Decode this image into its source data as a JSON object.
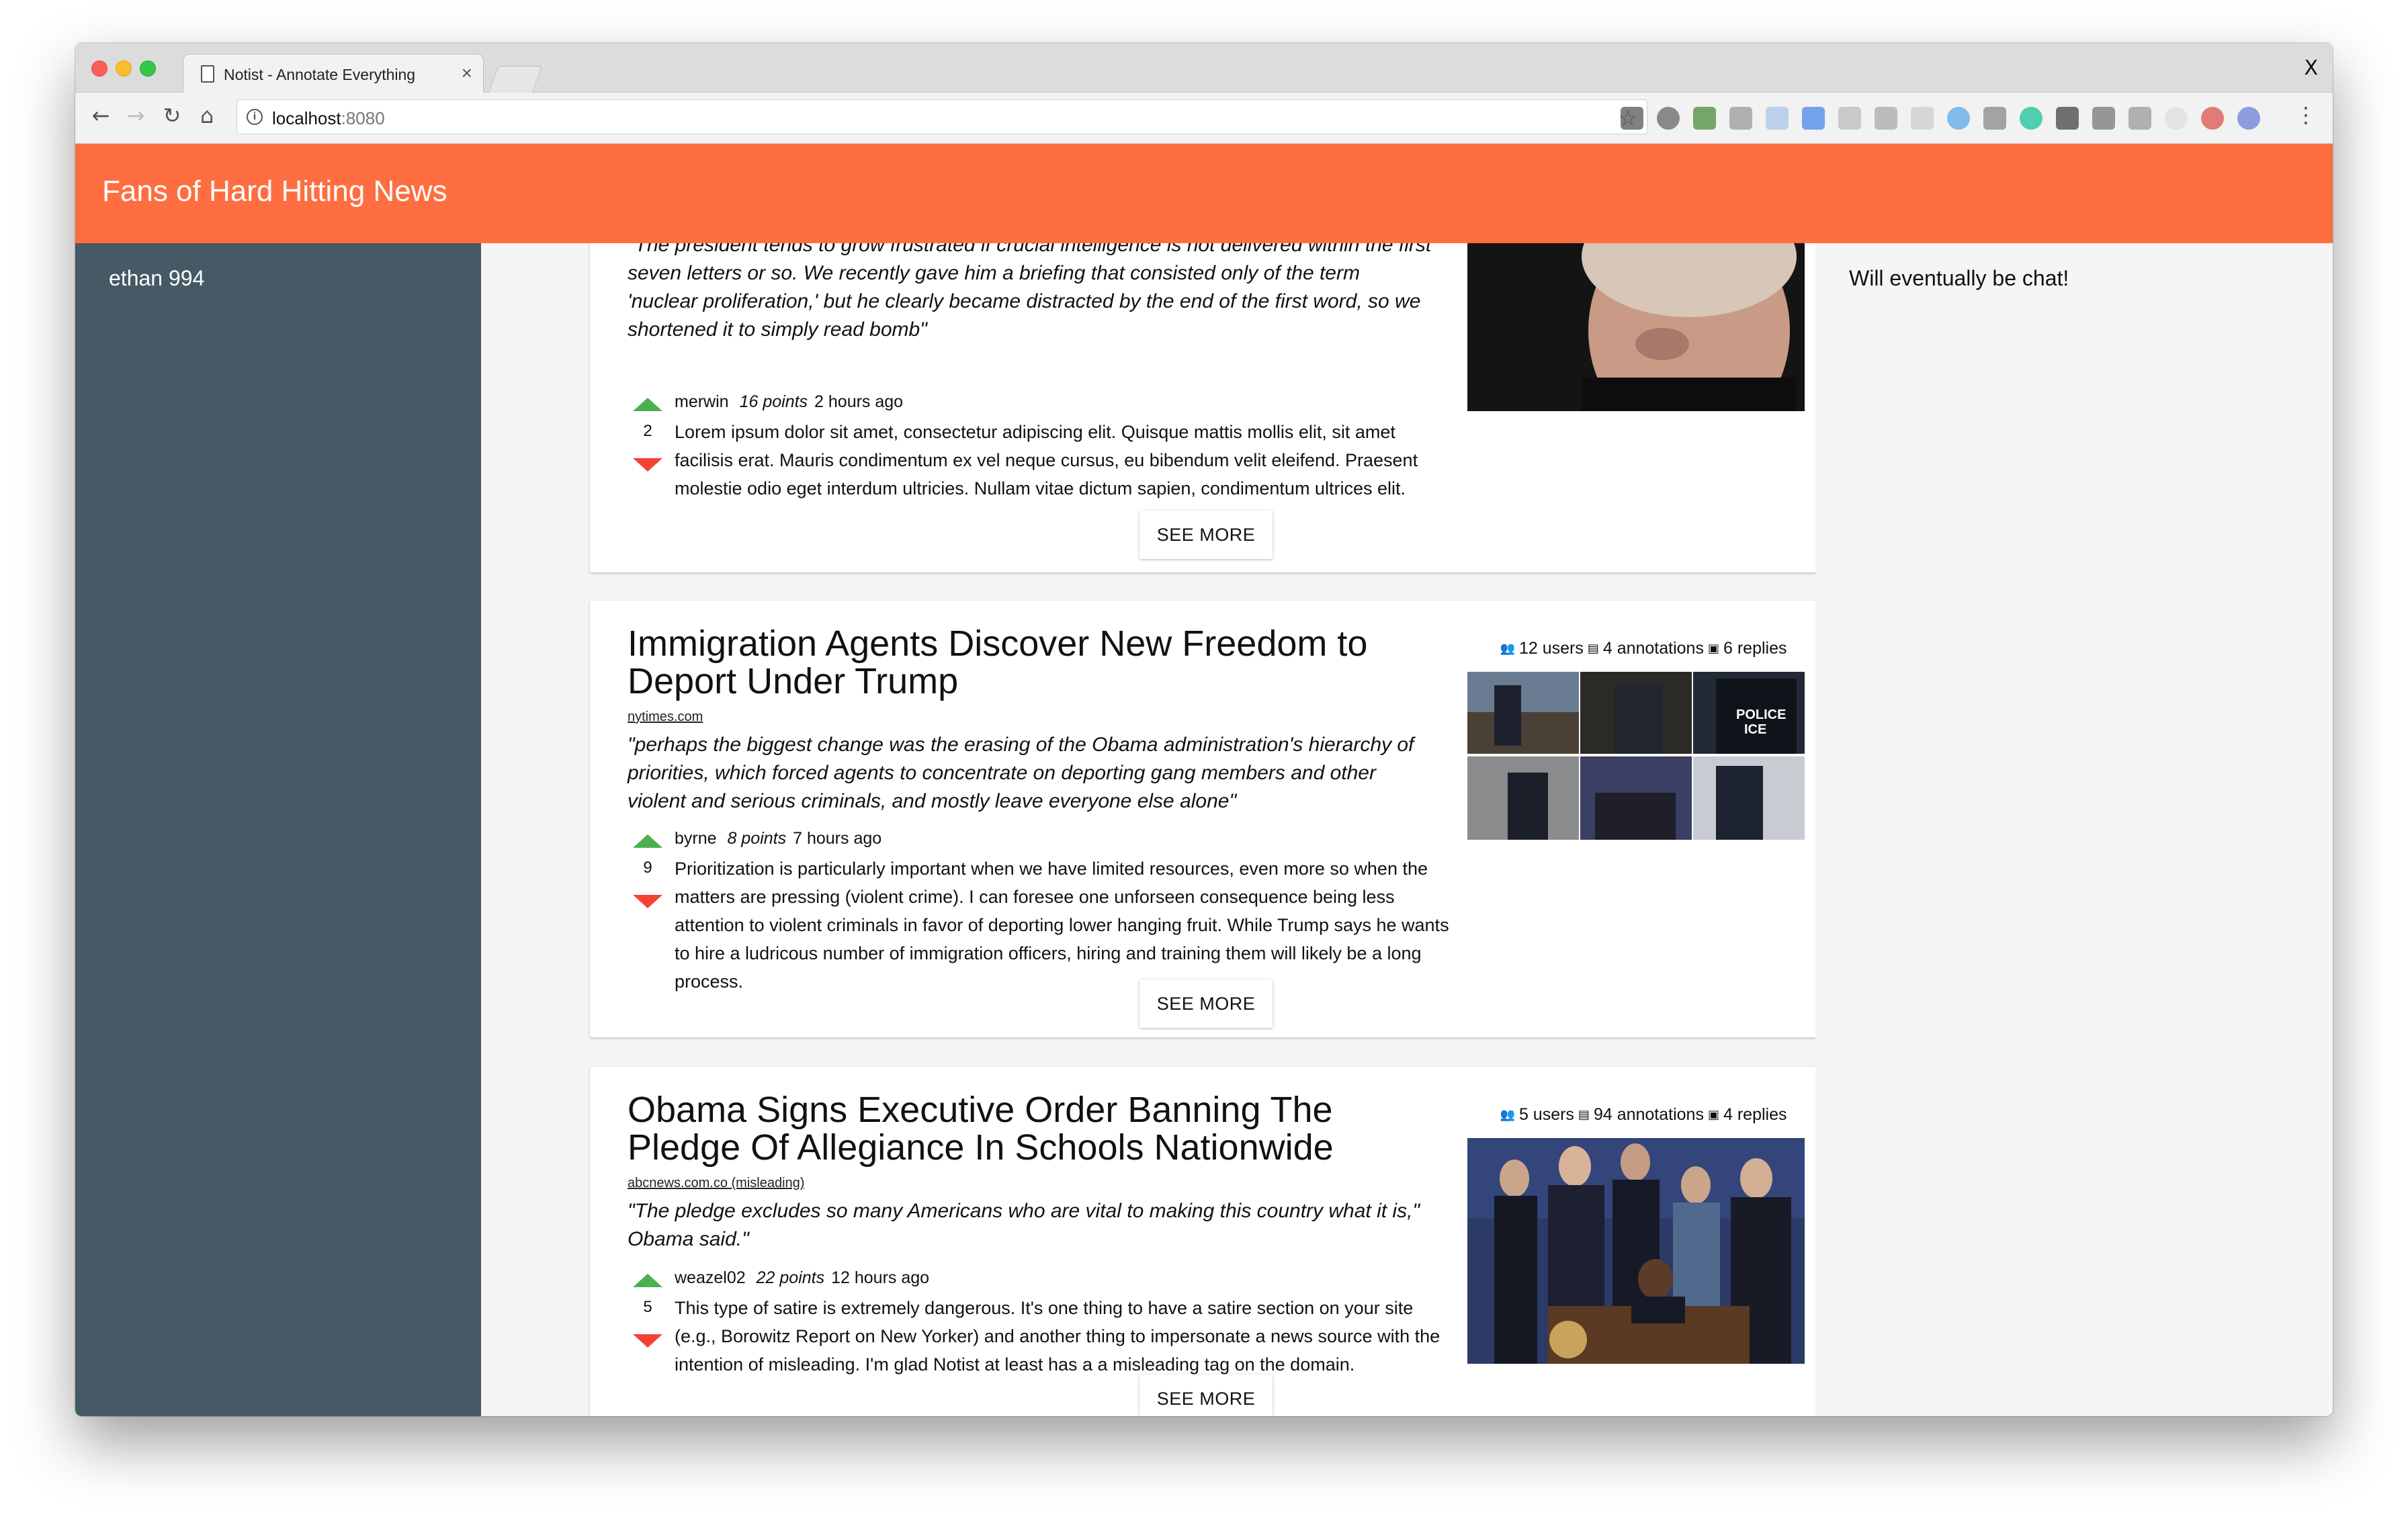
{
  "browser": {
    "tab_title": "Notist - Annotate Everything",
    "tab_close": "×",
    "window_close": "X",
    "url_host": "localhost",
    "url_port": ":8080"
  },
  "app": {
    "title": "Fans of Hard Hitting News",
    "sidebar_user": "ethan 994",
    "chat_placeholder": "Will eventually be chat!",
    "accent_color": "#ff6e40",
    "sidebar_color": "#455a64"
  },
  "cards": [
    {
      "quote": "\"The president tends to grow frustrated if crucial intelligence is not delivered within the first seven letters or so. We recently gave him a briefing that consisted only of the term 'nuclear proliferation,' but he clearly became distracted by the end of the first word, so we shortened it to simply read bomb\"",
      "comment": {
        "user": "merwin",
        "points": "16 points",
        "time": "2 hours ago",
        "votes": "2",
        "body": "Lorem ipsum dolor sit amet, consectetur adipiscing elit. Quisque mattis mollis elit, sit amet facilisis erat. Mauris condimentum ex vel neque cursus, eu bibendum velit eleifend. Praesent molestie odio eget interdum ultricies. Nullam vitae dictum sapien, condimentum ultrices elit."
      },
      "see_more": "SEE MORE"
    },
    {
      "title": "Immigration Agents Discover New Freedom to Deport Under Trump",
      "source": "nytimes.com",
      "quote": "\"perhaps the biggest change was the erasing of the Obama administration's hierarchy of priorities, which forced agents to concentrate on deporting gang members and other violent and serious criminals, and mostly leave everyone else alone\"",
      "stats": {
        "users": "12 users",
        "annotations": "4 annotations",
        "replies": "6 replies"
      },
      "comment": {
        "user": "byrne",
        "points": "8 points",
        "time": "7 hours ago",
        "votes": "9",
        "body": "Prioritization is particularly important when we have limited resources, even more so when the matters are pressing (violent crime). I can foresee one unforseen consequence being less attention to violent criminals in favor of deporting lower hanging fruit. While Trump says he wants to hire a ludricous number of immigration officers, hiring and training them will likely be a long process."
      },
      "see_more": "SEE MORE"
    },
    {
      "title": "Obama Signs Executive Order Banning The Pledge Of Allegiance In Schools Nationwide",
      "source": "abcnews.com.co (misleading)",
      "quote": "\"The pledge excludes so many Americans who are vital to making this country what it is,\" Obama said.\"",
      "stats": {
        "users": "5 users",
        "annotations": "94 annotations",
        "replies": "4 replies"
      },
      "comment": {
        "user": "weazel02",
        "points": "22 points",
        "time": "12 hours ago",
        "votes": "5",
        "body": "This type of satire is extremely dangerous. It's one thing to have a satire section on your site (e.g., Borowitz Report on New Yorker) and another thing to impersonate a news source with the intention of misleading. I'm glad Notist at least has a a misleading tag on the domain."
      },
      "see_more": "SEE MORE"
    }
  ],
  "icons": {
    "users": "people-icon",
    "annotations": "comment-icon",
    "replies": "forum-icon"
  }
}
